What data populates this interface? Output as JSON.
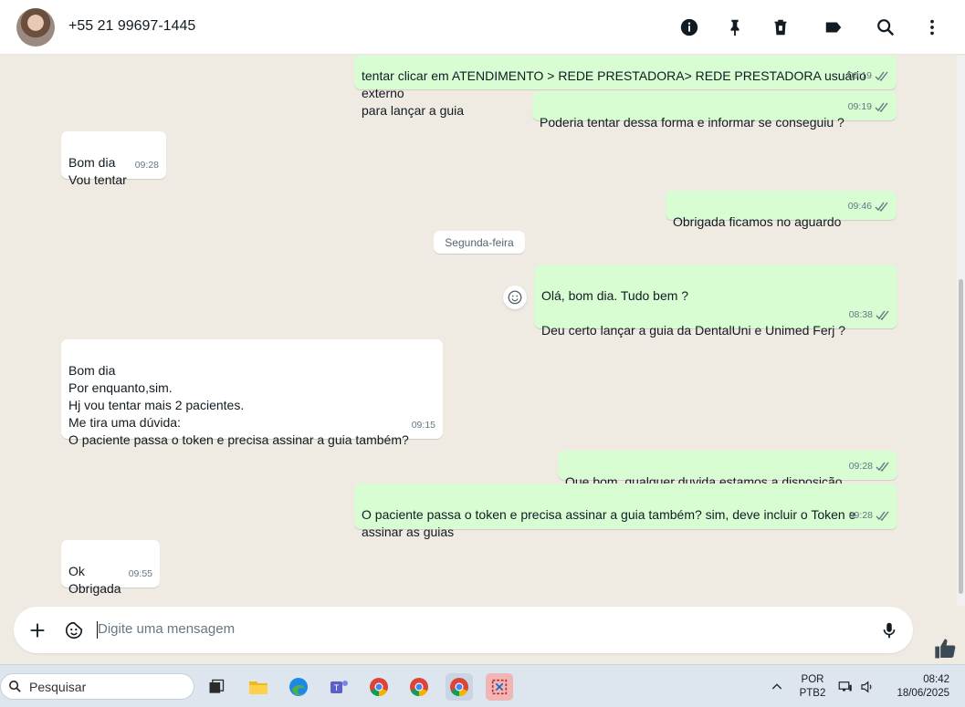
{
  "header": {
    "contact_name": "+55 21 99697-1445",
    "icons": [
      "info-icon",
      "pin-icon",
      "delete-icon",
      "label-icon",
      "search-icon",
      "menu-icon"
    ]
  },
  "chat": {
    "messages": [
      {
        "dir": "out",
        "text": "tentar clicar em ATENDIMENTO > REDE PRESTADORA> REDE PRESTADORA usuário externo\npara lançar a guia",
        "time": "09:19",
        "status": "read"
      },
      {
        "dir": "out",
        "text": "Poderia tentar dessa forma e informar se conseguiu ?",
        "time": "09:19",
        "status": "read"
      },
      {
        "dir": "in",
        "text": "Bom dia\nVou tentar",
        "time": "09:28"
      },
      {
        "dir": "out",
        "text": "Obrigada ficamos no aguardo",
        "time": "09:46",
        "status": "read"
      },
      {
        "dir": "out",
        "text": "Olá, bom dia. Tudo bem ?\n\nDeu certo lançar a guia da DentalUni e Unimed Ferj ?",
        "time": "08:38",
        "status": "read"
      },
      {
        "dir": "in",
        "text": "Bom dia\nPor enquanto,sim.\nHj vou tentar mais 2 pacientes.\nMe tira uma dúvida:\nO paciente passa o token e precisa assinar a guia também?",
        "time": "09:15"
      },
      {
        "dir": "out",
        "text": "Que bom, qualquer duvida estamos a disposição",
        "time": "09:28",
        "status": "read"
      },
      {
        "dir": "out",
        "text": "O paciente passa o token e precisa assinar a guia também? sim, deve incluir o Token e\nassinar as guias",
        "time": "09:28",
        "status": "read"
      },
      {
        "dir": "in",
        "text": "Ok\nObrigada",
        "time": "09:55"
      }
    ],
    "date_separator": "Segunda-feira",
    "reaction_icon": "emoji-icon"
  },
  "composer": {
    "placeholder": "Digite uma mensagem",
    "icons": [
      "plus-icon",
      "sticker-icon",
      "mic-icon"
    ]
  },
  "taskbar": {
    "search_placeholder": "Pesquisar",
    "language": "POR",
    "keyboard": "PTB2",
    "time": "08:42",
    "date": "18/06/2025"
  },
  "colors": {
    "outgoing_bubble": "#d9fdd3",
    "incoming_bubble": "#ffffff",
    "chat_background": "#efeae2",
    "read_ticks": "#667781"
  }
}
